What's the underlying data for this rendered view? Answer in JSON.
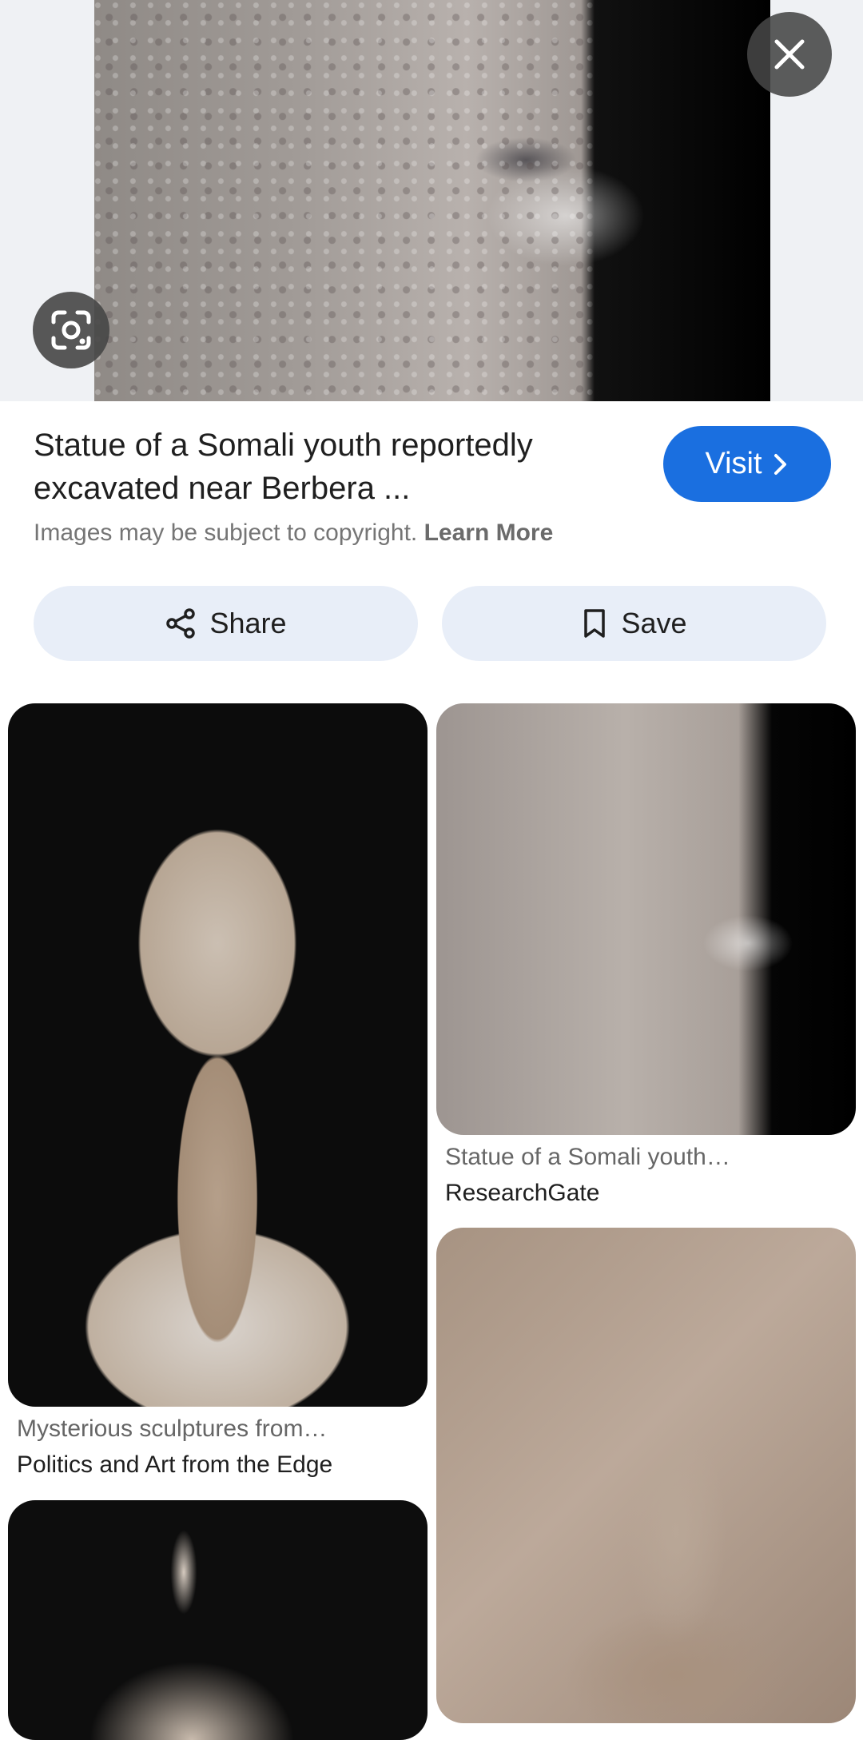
{
  "hero": {
    "close_icon": "close-icon",
    "lens_icon": "google-lens-icon"
  },
  "result": {
    "title": "Statue of a Somali youth reportedly excavated near Berbera ...",
    "visit_label": "Visit",
    "copyright_text": "Images may be subject to copyright.",
    "learn_more_label": "Learn More"
  },
  "actions": {
    "share_label": "Share",
    "save_label": "Save"
  },
  "related": [
    {
      "title": "Mysterious sculptures from…",
      "source": "Politics and Art from the Edge"
    },
    {
      "title": "Statue of a Somali youth…",
      "source": "ResearchGate"
    }
  ],
  "colors": {
    "accent": "#1a6fe0",
    "pill_bg": "#e8eef8",
    "hero_bg": "#eff1f4"
  }
}
